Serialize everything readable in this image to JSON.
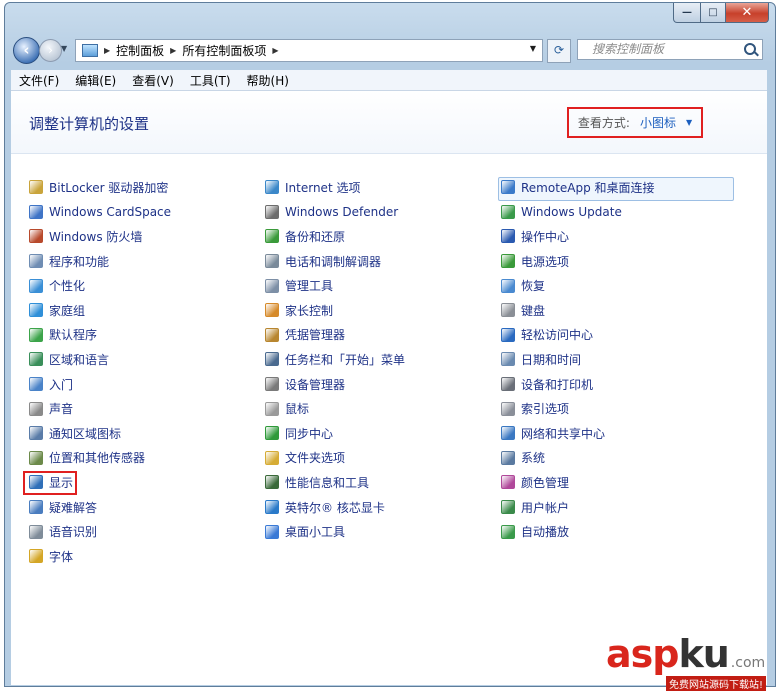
{
  "window": {
    "controls": {
      "minimize": "—",
      "maximize": "□",
      "close": "✕"
    }
  },
  "navigation": {
    "breadcrumbs": [
      "控制面板",
      "所有控制面板项"
    ],
    "search_placeholder": "搜索控制面板"
  },
  "menubar": {
    "items": [
      "文件(F)",
      "编辑(E)",
      "查看(V)",
      "工具(T)",
      "帮助(H)"
    ]
  },
  "main": {
    "title": "调整计算机的设置",
    "view_by_label": "查看方式:",
    "view_by_value": "小图标"
  },
  "columns": [
    {
      "items": [
        {
          "label": "BitLocker 驱动器加密",
          "icon": "bitlocker-icon",
          "color": "#c9a43b"
        },
        {
          "label": "Windows CardSpace",
          "icon": "cardspace-icon",
          "color": "#3f74c6"
        },
        {
          "label": "Windows 防火墙",
          "icon": "firewall-icon",
          "color": "#b84a2c"
        },
        {
          "label": "程序和功能",
          "icon": "programs-icon",
          "color": "#6f8db3"
        },
        {
          "label": "个性化",
          "icon": "personalization-icon",
          "color": "#3a8fd6"
        },
        {
          "label": "家庭组",
          "icon": "homegroup-icon",
          "color": "#2f8fd8"
        },
        {
          "label": "默认程序",
          "icon": "default-programs-icon",
          "color": "#3ca44a"
        },
        {
          "label": "区域和语言",
          "icon": "region-icon",
          "color": "#3a8f5a"
        },
        {
          "label": "入门",
          "icon": "getting-started-icon",
          "color": "#4a83c8"
        },
        {
          "label": "声音",
          "icon": "sound-icon",
          "color": "#8a8a8a"
        },
        {
          "label": "通知区域图标",
          "icon": "notification-icon",
          "color": "#5a7ca8"
        },
        {
          "label": "位置和其他传感器",
          "icon": "sensor-icon",
          "color": "#6c8a4a"
        },
        {
          "label": "显示",
          "icon": "display-icon",
          "color": "#2f6fb8"
        },
        {
          "label": "疑难解答",
          "icon": "troubleshoot-icon",
          "color": "#4a7dbf"
        },
        {
          "label": "语音识别",
          "icon": "speech-icon",
          "color": "#7f8c99"
        },
        {
          "label": "字体",
          "icon": "fonts-icon",
          "color": "#d4a626"
        }
      ]
    },
    {
      "items": [
        {
          "label": "Internet 选项",
          "icon": "internet-options-icon",
          "color": "#3b88c9"
        },
        {
          "label": "Windows Defender",
          "icon": "defender-icon",
          "color": "#6d6d6d"
        },
        {
          "label": "备份和还原",
          "icon": "backup-icon",
          "color": "#3a9a3a"
        },
        {
          "label": "电话和调制解调器",
          "icon": "phone-modem-icon",
          "color": "#7a8a9a"
        },
        {
          "label": "管理工具",
          "icon": "admin-tools-icon",
          "color": "#7d8fa6"
        },
        {
          "label": "家长控制",
          "icon": "parental-icon",
          "color": "#d68a2a"
        },
        {
          "label": "凭据管理器",
          "icon": "credential-icon",
          "color": "#b8862f"
        },
        {
          "label": "任务栏和「开始」菜单",
          "icon": "taskbar-icon",
          "color": "#4a6a8f"
        },
        {
          "label": "设备管理器",
          "icon": "device-manager-icon",
          "color": "#7a7a7a"
        },
        {
          "label": "鼠标",
          "icon": "mouse-icon",
          "color": "#9a9a9a"
        },
        {
          "label": "同步中心",
          "icon": "sync-icon",
          "color": "#2f9a3a"
        },
        {
          "label": "文件夹选项",
          "icon": "folder-options-icon",
          "color": "#d6ac35"
        },
        {
          "label": "性能信息和工具",
          "icon": "performance-icon",
          "color": "#3a6a3a"
        },
        {
          "label": "英特尔® 核芯显卡",
          "icon": "intel-icon",
          "color": "#2a7ac9"
        },
        {
          "label": "桌面小工具",
          "icon": "gadgets-icon",
          "color": "#3a7ad6"
        }
      ]
    },
    {
      "items": [
        {
          "label": "RemoteApp 和桌面连接",
          "icon": "remoteapp-icon",
          "color": "#3a7ac9"
        },
        {
          "label": "Windows Update",
          "icon": "windows-update-icon",
          "color": "#3a9a4a"
        },
        {
          "label": "操作中心",
          "icon": "action-center-icon",
          "color": "#2a5ab0"
        },
        {
          "label": "电源选项",
          "icon": "power-icon",
          "color": "#3a9a3a"
        },
        {
          "label": "恢复",
          "icon": "recovery-icon",
          "color": "#4a8ad0"
        },
        {
          "label": "键盘",
          "icon": "keyboard-icon",
          "color": "#8a8f96"
        },
        {
          "label": "轻松访问中心",
          "icon": "ease-of-access-icon",
          "color": "#2a6ac0"
        },
        {
          "label": "日期和时间",
          "icon": "datetime-icon",
          "color": "#6a8ab0"
        },
        {
          "label": "设备和打印机",
          "icon": "printer-icon",
          "color": "#6a6f78"
        },
        {
          "label": "索引选项",
          "icon": "indexing-icon",
          "color": "#8a8f99"
        },
        {
          "label": "网络和共享中心",
          "icon": "network-icon",
          "color": "#3a78c2"
        },
        {
          "label": "系统",
          "icon": "system-icon",
          "color": "#5a7aa0"
        },
        {
          "label": "颜色管理",
          "icon": "color-management-icon",
          "color": "#b0489a"
        },
        {
          "label": "用户帐户",
          "icon": "user-accounts-icon",
          "color": "#3a8a4a"
        },
        {
          "label": "自动播放",
          "icon": "autoplay-icon",
          "color": "#3a9a4a"
        }
      ]
    }
  ],
  "colors": {
    "link": "#1e3287",
    "highlight": "#e02020",
    "accent": "#1c5fbf"
  },
  "watermark": {
    "brand_main": "asp",
    "brand_accent": "ku",
    "domain": ".com",
    "tagline": "免费网站源码下载站!"
  }
}
